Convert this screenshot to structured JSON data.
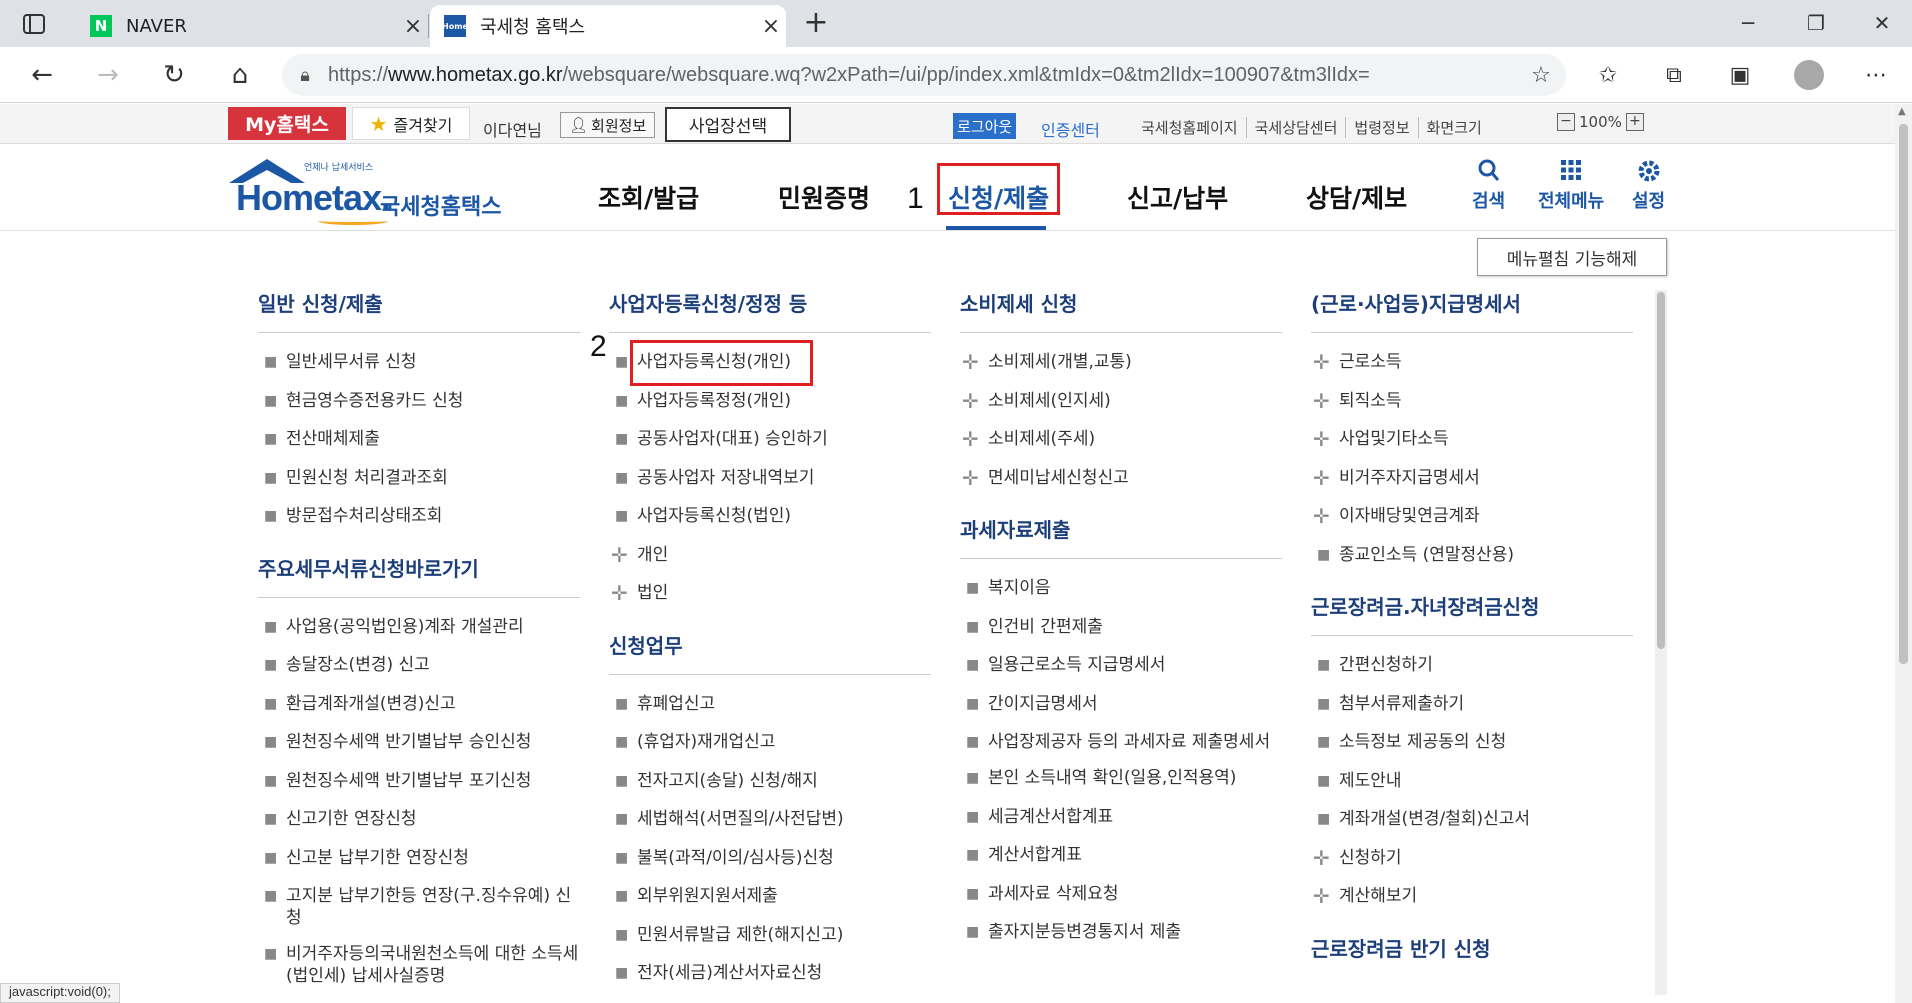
{
  "browser": {
    "tabs": [
      {
        "title": "NAVER",
        "favicon": "naver-icon"
      },
      {
        "title": "국세청 홈택스",
        "favicon": "hometax-icon"
      }
    ],
    "url_prefix": "https://",
    "url_domain": "www.hometax.go.kr",
    "url_path": "/websquare/websquare.wq?w2xPath=/ui/pp/index.xml&tmIdx=0&tm2lIdx=100907&tm3lIdx="
  },
  "util": {
    "my_hometax": "My홈택스",
    "favorites": "즐겨찾기",
    "username": "이다연님",
    "member_info": "회원정보",
    "biz_select": "사업장선택",
    "logout": "로그아웃",
    "cert_center": "인증센터",
    "links": [
      "국세청홈페이지",
      "국세상담센터",
      "법령정보",
      "화면크기"
    ],
    "zoom": "100%"
  },
  "logo": {
    "small": "언제나 납세서비스",
    "brand": "Hometax.",
    "korean": "국세청홈택스"
  },
  "gnb": {
    "menus": [
      "조회/발급",
      "민원증명",
      "신청/제출",
      "신고/납부",
      "상담/제보"
    ],
    "active": "신청/제출",
    "icons": [
      {
        "label": "검색",
        "icon": "search-icon"
      },
      {
        "label": "전체메뉴",
        "icon": "grid-icon"
      },
      {
        "label": "설정",
        "icon": "gear-icon"
      }
    ]
  },
  "annotations": {
    "step1": "1",
    "step2": "2"
  },
  "unfold_button": "메뉴펼침 기능해제",
  "columns": {
    "c1": {
      "sections": [
        {
          "title": "일반 신청/제출",
          "items": [
            "일반세무서류 신청",
            "현금영수증전용카드 신청",
            "전산매체제출",
            "민원신청 처리결과조회",
            "방문접수처리상태조회"
          ]
        },
        {
          "title": "주요세무서류신청바로가기",
          "items": [
            "사업용(공익법인용)계좌 개설관리",
            "송달장소(변경) 신고",
            "환급계좌개설(변경)신고",
            "원천징수세액 반기별납부 승인신청",
            "원천징수세액 반기별납부 포기신청",
            "신고기한 연장신청",
            "신고분 납부기한 연장신청",
            "고지분 납부기한등 연장(구.징수유예) 신청",
            "비거주자등의국내원천소득에 대한 소득세(법인세) 납세사실증명"
          ]
        }
      ]
    },
    "c2": {
      "sections": [
        {
          "title": "사업자등록신청/정정 등",
          "items": [
            "사업자등록신청(개인)",
            "사업자등록정정(개인)",
            "공동사업자(대표) 승인하기",
            "공동사업자 저장내역보기",
            "사업자등록신청(법인)"
          ],
          "sub": [
            "개인",
            "법인"
          ]
        },
        {
          "title": "신청업무",
          "items": [
            "휴폐업신고",
            "(휴업자)재개업신고",
            "전자고지(송달) 신청/해지",
            "세법해석(서면질의/사전답변)",
            "불복(과적/이의/심사등)신청",
            "외부위원지원서제출",
            "민원서류발급 제한(해지신고)",
            "전자(세금)계산서자료신청"
          ]
        }
      ]
    },
    "c3": {
      "sections": [
        {
          "title": "소비제세 신청",
          "plus_items": [
            "소비제세(개별,교통)",
            "소비제세(인지세)",
            "소비제세(주세)",
            "면세미납세신청신고"
          ]
        },
        {
          "title": "과세자료제출",
          "items": [
            "복지이음",
            "인건비 간편제출",
            "일용근로소득 지급명세서",
            "간이지급명세서",
            "사업장제공자 등의 과세자료 제출명세서",
            "본인 소득내역 확인(일용,인적용역)",
            "세금계산서합계표",
            "계산서합계표",
            "과세자료 삭제요청",
            "출자지분등변경통지서 제출"
          ]
        }
      ]
    },
    "c4": {
      "sections": [
        {
          "title": "(근로·사업등)지급명세서",
          "plus_items": [
            "근로소득",
            "퇴직소득",
            "사업및기타소득",
            "비거주자지급명세서",
            "이자배당및연금계좌"
          ],
          "items": [
            "종교인소득 (연말정산용)"
          ]
        },
        {
          "title": "근로장려금.자녀장려금신청",
          "items": [
            "간편신청하기",
            "첨부서류제출하기",
            "소득정보 제공동의 신청",
            "제도안내",
            "계좌개설(변경/철회)신고서"
          ],
          "plus_items2": [
            "신청하기",
            "계산해보기"
          ]
        },
        {
          "title": "근로장려금 반기 신청"
        }
      ]
    }
  },
  "status_bar": "javascript:void(0);"
}
